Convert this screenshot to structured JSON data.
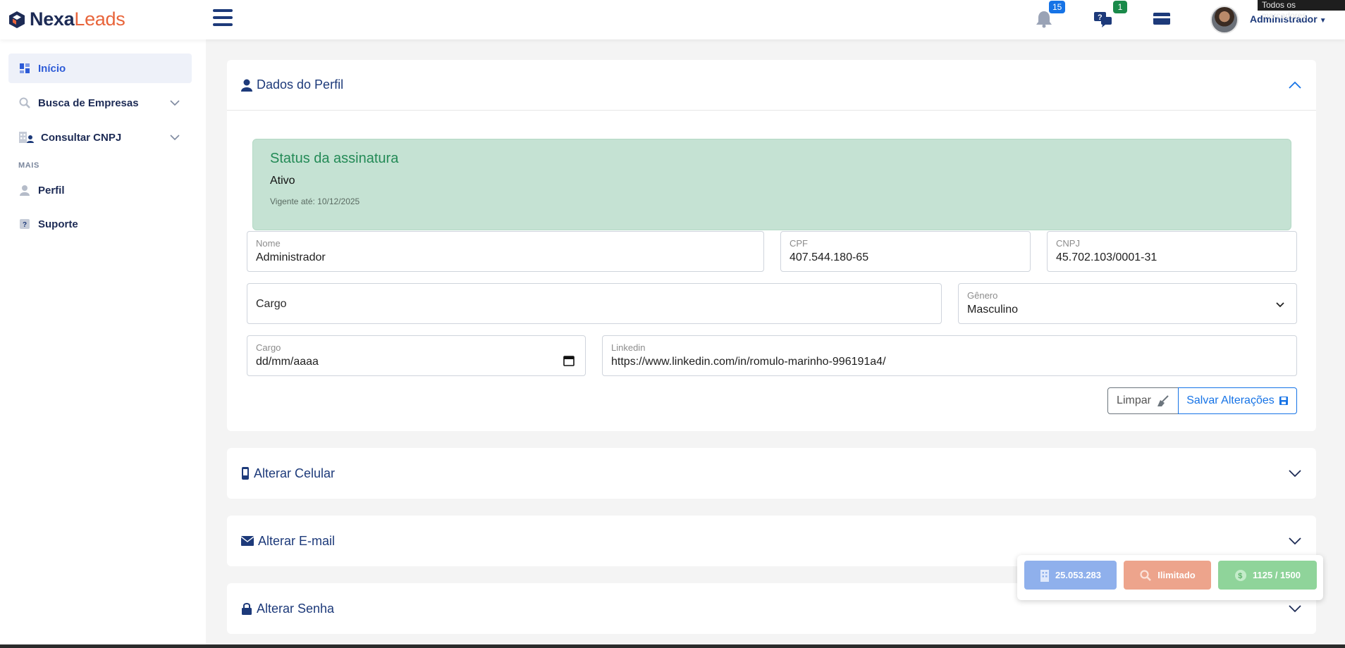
{
  "brand": {
    "name_part1": "Nexa",
    "name_part2": "Leads",
    "accent_color": "#e8643a",
    "primary_color": "#1d2b55"
  },
  "header": {
    "notifications_count": "15",
    "messages_count": "1",
    "user_name": "Administrador",
    "tooltip": "Todos os marcadores",
    "icons": [
      "hamburger-icon",
      "bell-icon",
      "chat-question-icon",
      "credit-card-icon"
    ]
  },
  "sidebar": {
    "items": [
      {
        "label": "Início",
        "icon": "grid-icon",
        "active": true
      },
      {
        "label": "Busca de Empresas",
        "icon": "search-icon",
        "expandable": true
      },
      {
        "label": "Consultar CNPJ",
        "icon": "building-user-icon",
        "expandable": true
      }
    ],
    "section_label": "MAIS",
    "more_items": [
      {
        "label": "Perfil",
        "icon": "user-icon"
      },
      {
        "label": "Suporte",
        "icon": "help-icon"
      }
    ]
  },
  "profile": {
    "title": "Dados do Perfil",
    "subscription": {
      "title": "Status da assinatura",
      "status": "Ativo",
      "validity": "Vigente até: 10/12/2025"
    },
    "fields": {
      "nome": {
        "label": "Nome",
        "value": "Administrador"
      },
      "cpf": {
        "label": "CPF",
        "value": "407.544.180-65"
      },
      "cnpj": {
        "label": "CNPJ",
        "value": "45.702.103/0001-31"
      },
      "cargo": {
        "placeholder": "Cargo"
      },
      "genero": {
        "label": "Gênero",
        "value": "Masculino"
      },
      "data": {
        "label": "Cargo",
        "value": "dd/mm/aaaa"
      },
      "linkedin": {
        "label": "Linkedin",
        "value": "https://www.linkedin.com/in/romulo-marinho-996191a4/"
      }
    },
    "buttons": {
      "clear": "Limpar",
      "save": "Salvar Alterações"
    }
  },
  "sections": [
    {
      "title": "Alterar Celular",
      "icon": "phone-icon"
    },
    {
      "title": "Alterar E-mail",
      "icon": "envelope-icon"
    },
    {
      "title": "Alterar Senha",
      "icon": "lock-icon"
    }
  ],
  "stats": {
    "companies": "25.053.283",
    "search": "Ilimitado",
    "credits": "1125 / 1500",
    "colors": {
      "companies": "#8fb0ec",
      "search": "#eda48c",
      "credits": "#8fd49a"
    }
  }
}
